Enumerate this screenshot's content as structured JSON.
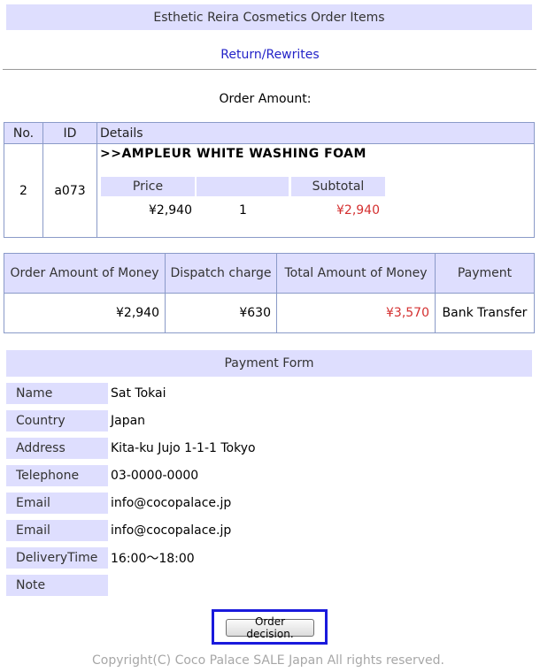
{
  "header": {
    "title": "Esthetic Reira Cosmetics Order Items"
  },
  "nav": {
    "return_link": "Return/Rewrites"
  },
  "order_amount_label": "Order Amount:",
  "items_table": {
    "headers": {
      "no": "No.",
      "id": "ID",
      "details": "Details"
    },
    "row": {
      "no": "2",
      "id": "a073",
      "product_name": ">>AMPLEUR WHITE WASHING FOAM",
      "sub_headers": {
        "price": "Price",
        "qty": "",
        "subtotal": "Subtotal"
      },
      "price": "¥2,940",
      "qty": "1",
      "subtotal": "¥2,940"
    }
  },
  "totals_table": {
    "headers": {
      "order_amount": "Order Amount of Money",
      "dispatch": "Dispatch charge",
      "total": "Total Amount of Money",
      "payment": "Payment"
    },
    "values": {
      "order_amount": "¥2,940",
      "dispatch": "¥630",
      "total": "¥3,570",
      "payment": "Bank Transfer"
    }
  },
  "payment_form": {
    "title": "Payment Form",
    "fields": [
      {
        "label": "Name",
        "value": "Sat Tokai"
      },
      {
        "label": "Country",
        "value": "Japan"
      },
      {
        "label": "Address",
        "value": "Kita-ku Jujo 1-1-1 Tokyo"
      },
      {
        "label": "Telephone",
        "value": "03-0000-0000"
      },
      {
        "label": "Email",
        "value": "info@cocopalace.jp"
      },
      {
        "label": "Email",
        "value": "info@cocopalace.jp"
      },
      {
        "label": "DeliveryTime",
        "value": "16:00～18:00"
      },
      {
        "label": "Note",
        "value": ""
      }
    ]
  },
  "actions": {
    "order_decision": "Order decision."
  },
  "footer": {
    "copyright": "Copyright(C) Coco Palace SALE Japan All rights reserved."
  },
  "colors": {
    "accent_bg": "#dedefe",
    "link": "#2323c8",
    "price_red": "#d43030",
    "focus_border": "#1a1adc"
  }
}
